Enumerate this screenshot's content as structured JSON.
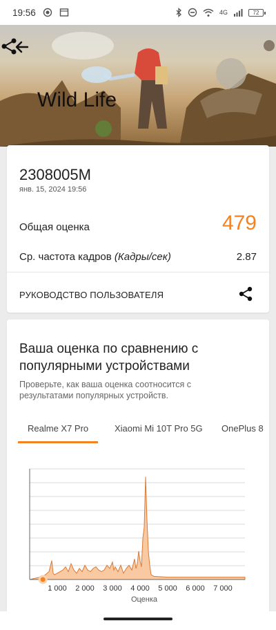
{
  "status_bar": {
    "time": "19:56",
    "network": "4G",
    "battery": "72"
  },
  "hero": {
    "title": "Wild Life"
  },
  "result": {
    "device": "2308005M",
    "datetime": "янв. 15, 2024 19:56",
    "overall_label": "Общая оценка",
    "overall_value": "479",
    "fps_label_prefix": "Ср. частота кадров ",
    "fps_label_unit": "(Кадры/сек)",
    "fps_value": "2.87",
    "guide_label": "РУКОВОДСТВО ПОЛЬЗОВАТЕЛЯ"
  },
  "comparison": {
    "title": "Ваша оценка по сравнению с популярными устройствами",
    "subtitle": "Проверьте, как ваша оценка соотносится с результатами популярных устройств.",
    "tabs": [
      "Realme X7 Pro",
      "Xiaomi Mi 10T Pro 5G",
      "OnePlus 8"
    ],
    "active_tab": 0
  },
  "chart_data": {
    "type": "area",
    "xlabel": "Оценка",
    "ylabel": "",
    "xlim": [
      0,
      7800
    ],
    "x_ticks": [
      "1 000",
      "2 000",
      "3 000",
      "4 000",
      "5 000",
      "6 000",
      "7 000"
    ],
    "x_tick_values": [
      1000,
      2000,
      3000,
      4000,
      5000,
      6000,
      7000
    ],
    "gridlines": 8,
    "your_score": 479,
    "colors": {
      "fill": "#f9c9a2",
      "stroke": "#d97a36",
      "marker": "#f58220"
    },
    "x": [
      0,
      500,
      700,
      800,
      850,
      900,
      1000,
      1200,
      1300,
      1400,
      1500,
      1600,
      1700,
      1800,
      1900,
      2000,
      2100,
      2200,
      2300,
      2400,
      2500,
      2600,
      2700,
      2800,
      2900,
      3000,
      3050,
      3100,
      3200,
      3300,
      3400,
      3500,
      3600,
      3700,
      3800,
      3850,
      3900,
      3950,
      4000,
      4050,
      4100,
      4150,
      4200,
      4250,
      4300,
      4350,
      4400,
      4500,
      5000,
      6000,
      7000,
      7800
    ],
    "y": [
      0,
      0.2,
      0.5,
      1.2,
      0.4,
      0.3,
      0.4,
      0.6,
      0.8,
      0.5,
      1.0,
      0.6,
      0.4,
      0.7,
      0.5,
      0.9,
      0.6,
      0.5,
      0.7,
      0.8,
      0.6,
      0.5,
      0.6,
      0.9,
      0.7,
      1.1,
      0.6,
      0.8,
      0.5,
      0.9,
      0.4,
      0.7,
      0.9,
      0.6,
      1.3,
      0.7,
      1.0,
      1.8,
      1.2,
      0.8,
      2.6,
      3.3,
      6.5,
      3.8,
      1.8,
      0.9,
      0.3,
      0.2,
      0.15,
      0.15,
      0.15,
      0.15
    ],
    "ymax": 7
  }
}
